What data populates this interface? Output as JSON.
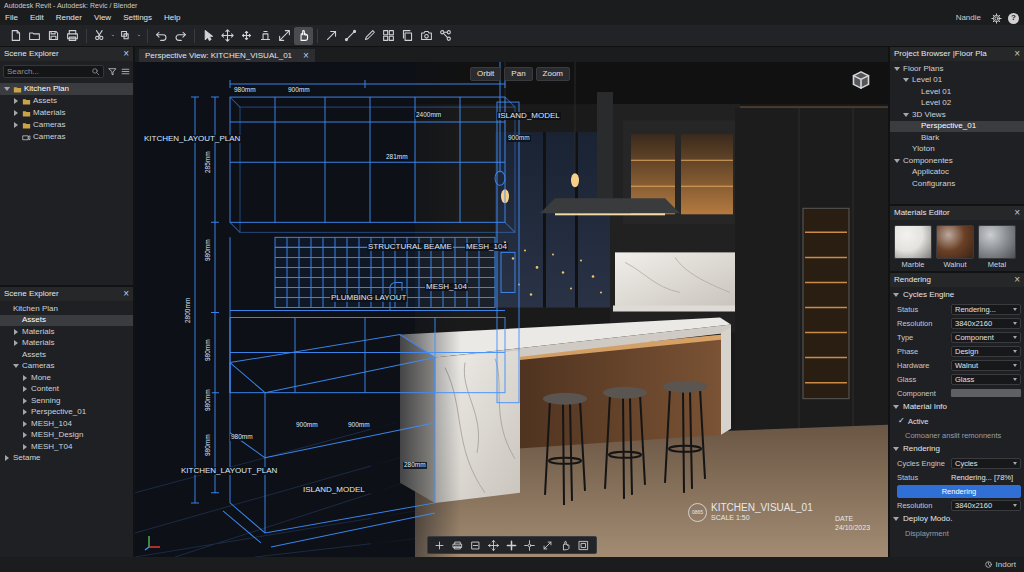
{
  "window": {
    "title": "Autodesk Revit - Autodesk: Revic / Blender"
  },
  "menu": [
    "File",
    "Edit",
    "Render",
    "View",
    "Settings",
    "Help"
  ],
  "account": {
    "user": "Nandie",
    "help": "?"
  },
  "toolbar": [
    {
      "selected": false
    },
    {
      "selected": false
    },
    {
      "selected": false
    },
    {
      "selected": false
    },
    {
      "selected": false
    },
    {
      "selected": false
    },
    {
      "selected": false
    },
    {
      "selected": false
    },
    {
      "selected": false
    },
    {
      "selected": false
    },
    {
      "selected": false
    },
    {
      "selected": false
    },
    {
      "selected": false
    },
    {
      "selected": true
    },
    {
      "selected": false
    },
    {
      "selected": false
    },
    {
      "selected": false
    },
    {
      "selected": false
    },
    {
      "selected": false
    },
    {
      "selected": false
    },
    {
      "selected": false
    }
  ],
  "scene_explorer": {
    "title": "Scene Explorer",
    "close": "×",
    "search": {
      "placeholder": "Search..."
    },
    "items": [
      {
        "label": "Kitchen Plan",
        "depth": 0,
        "kind": "branch",
        "expanded": true,
        "selected": true
      },
      {
        "label": "Assets",
        "depth": 1,
        "kind": "branch",
        "expanded": false,
        "selected": false
      },
      {
        "label": "Materials",
        "depth": 1,
        "kind": "branch",
        "expanded": false,
        "selected": false
      },
      {
        "label": "Cameras",
        "depth": 1,
        "kind": "branch",
        "expanded": false,
        "selected": false
      },
      {
        "label": "Cameras",
        "depth": 1,
        "kind": "leaf",
        "selected": false
      }
    ]
  },
  "scene_explorer_2": {
    "title": "Scene Explorer",
    "close": "×",
    "items": [
      {
        "label": "Kitchen Plan",
        "depth": 0,
        "kind": "leaf",
        "selected": false
      },
      {
        "label": "Assets",
        "depth": 1,
        "kind": "leaf",
        "selected": true
      },
      {
        "label": "Materials",
        "depth": 1,
        "kind": "branch",
        "expanded": false,
        "selected": false
      },
      {
        "label": "Materials",
        "depth": 1,
        "kind": "branch",
        "expanded": false,
        "selected": false
      },
      {
        "label": "Assets",
        "depth": 1,
        "kind": "leaf",
        "selected": false
      },
      {
        "label": "Cameras",
        "depth": 1,
        "kind": "branch",
        "expanded": true,
        "selected": false
      },
      {
        "label": "Mone",
        "depth": 2,
        "kind": "branch",
        "expanded": false,
        "selected": false
      },
      {
        "label": "Content",
        "depth": 2,
        "kind": "branch",
        "expanded": false,
        "selected": false
      },
      {
        "label": "Senning",
        "depth": 2,
        "kind": "branch",
        "expanded": false,
        "selected": false
      },
      {
        "label": "Perspective_01",
        "depth": 2,
        "kind": "branch",
        "expanded": false,
        "selected": false
      },
      {
        "label": "MESH_104",
        "depth": 2,
        "kind": "branch",
        "expanded": false,
        "selected": false
      },
      {
        "label": "MESH_Design",
        "depth": 2,
        "kind": "branch",
        "expanded": false,
        "selected": false
      },
      {
        "label": "MESH_T04",
        "depth": 2,
        "kind": "branch",
        "expanded": false,
        "selected": false
      },
      {
        "label": "Setame",
        "depth": 0,
        "kind": "branch",
        "expanded": false,
        "selected": false
      }
    ]
  },
  "viewport": {
    "tab": {
      "label": "Perspective View: KITCHEN_VISUAL_01",
      "close": "×",
      "selected": true
    },
    "nav": [
      "Orbit",
      "Pan",
      "Zoom"
    ],
    "annotations": [
      {
        "text": "980mm",
        "kind": "dim"
      },
      {
        "text": "900mm",
        "kind": "dim"
      },
      {
        "text": "2400mm",
        "kind": "dim"
      },
      {
        "text": "ISLAND_MODEL",
        "kind": "label"
      },
      {
        "text": "KITCHEN_LAYOUT_PLAN",
        "kind": "label"
      },
      {
        "text": "900mm",
        "kind": "dim"
      },
      {
        "text": "285mm",
        "kind": "dim"
      },
      {
        "text": "281mm",
        "kind": "dim"
      },
      {
        "text": "980mm",
        "kind": "dim"
      },
      {
        "text": "2800mm",
        "kind": "dim"
      },
      {
        "text": "980mm",
        "kind": "dim"
      },
      {
        "text": "STRUCTURAL BEAME",
        "kind": "label"
      },
      {
        "text": "MESH_104",
        "kind": "label"
      },
      {
        "text": "MESH_104",
        "kind": "label"
      },
      {
        "text": "PLUMBING LAYOUT",
        "kind": "label"
      },
      {
        "text": "980mm",
        "kind": "dim"
      },
      {
        "text": "980mm",
        "kind": "dim"
      },
      {
        "text": "980mm",
        "kind": "dim"
      },
      {
        "text": "900mm",
        "kind": "dim"
      },
      {
        "text": "900mm",
        "kind": "dim"
      },
      {
        "text": "280mm",
        "kind": "dim"
      },
      {
        "text": "KITCHEN_LAYOUT_PLAN",
        "kind": "label"
      },
      {
        "text": "ISLAND_MODEL",
        "kind": "label"
      }
    ],
    "stamp": {
      "title": "KITCHEN_VISUAL_01",
      "code": "0865",
      "scale": "SCALE 1:50",
      "date_label": "DATE",
      "date": "24/10/2023"
    }
  },
  "project_browser": {
    "title": "Project Browser |Floor Pla",
    "close": "×",
    "items": [
      {
        "label": "Floor Plans",
        "depth": 0,
        "kind": "branch",
        "expanded": true,
        "selected": false
      },
      {
        "label": "Level 01",
        "depth": 1,
        "kind": "branch",
        "expanded": true,
        "selected": false
      },
      {
        "label": "Level 01",
        "depth": 2,
        "kind": "leaf",
        "selected": false
      },
      {
        "label": "Level 02",
        "depth": 2,
        "kind": "leaf",
        "selected": false
      },
      {
        "label": "3D Views",
        "depth": 1,
        "kind": "branch",
        "expanded": true,
        "selected": false
      },
      {
        "label": "Perspective_01",
        "depth": 2,
        "kind": "leaf",
        "selected": true
      },
      {
        "label": "Biark",
        "depth": 2,
        "kind": "leaf",
        "selected": false
      },
      {
        "label": "Yloton",
        "depth": 1,
        "kind": "leaf",
        "selected": false
      },
      {
        "label": "Componentes",
        "depth": 0,
        "kind": "branch",
        "expanded": true,
        "selected": false
      },
      {
        "label": "Applicatoc",
        "depth": 1,
        "kind": "leaf",
        "selected": false
      },
      {
        "label": "Configurans",
        "depth": 1,
        "kind": "leaf",
        "selected": false
      }
    ]
  },
  "materials_editor": {
    "title": "Materials Editor",
    "close": "×",
    "swatches": [
      {
        "name": "Marble",
        "color": "#e4e2de"
      },
      {
        "name": "Walnut",
        "color": "#6a4026"
      },
      {
        "name": "Metal",
        "color": "#8c9095"
      }
    ]
  },
  "rendering": {
    "title": "Rendering",
    "close": "×",
    "sections": [
      {
        "title": "Cycles Engine",
        "expanded": true,
        "rows": [
          {
            "kind": "select",
            "label": "Status",
            "value": "Rendering..."
          },
          {
            "kind": "select",
            "label": "Resolution",
            "value": "3840x2160"
          },
          {
            "kind": "select",
            "label": "Type",
            "value": "Component"
          },
          {
            "kind": "select",
            "label": "Phase",
            "value": "Design"
          },
          {
            "kind": "select",
            "label": "Hardware",
            "value": "Walnut"
          },
          {
            "kind": "select",
            "label": "Glass",
            "value": "Glass"
          },
          {
            "kind": "swatch",
            "label": "Component"
          }
        ]
      },
      {
        "title": "Material Info",
        "expanded": true,
        "rows": [
          {
            "kind": "check",
            "mark": "✓",
            "label": "Active",
            "checked": true
          },
          {
            "kind": "note",
            "label": "Comoaner anslit remonnents"
          }
        ]
      },
      {
        "title": "Rendering",
        "expanded": true,
        "rows": [
          {
            "kind": "select",
            "label": "Cycles Engine",
            "value": "Cycles"
          },
          {
            "kind": "text",
            "label": "Status",
            "value": "Rendering... [78%]"
          },
          {
            "kind": "button",
            "label": "Rendering"
          },
          {
            "kind": "select",
            "label": "Resolution",
            "value": "3840x2160"
          }
        ]
      },
      {
        "title": "Deploy Modo.",
        "expanded": true,
        "rows": [
          {
            "kind": "note",
            "label": "Displayrment"
          }
        ]
      }
    ]
  },
  "status_bar": {
    "text": "Indort"
  }
}
